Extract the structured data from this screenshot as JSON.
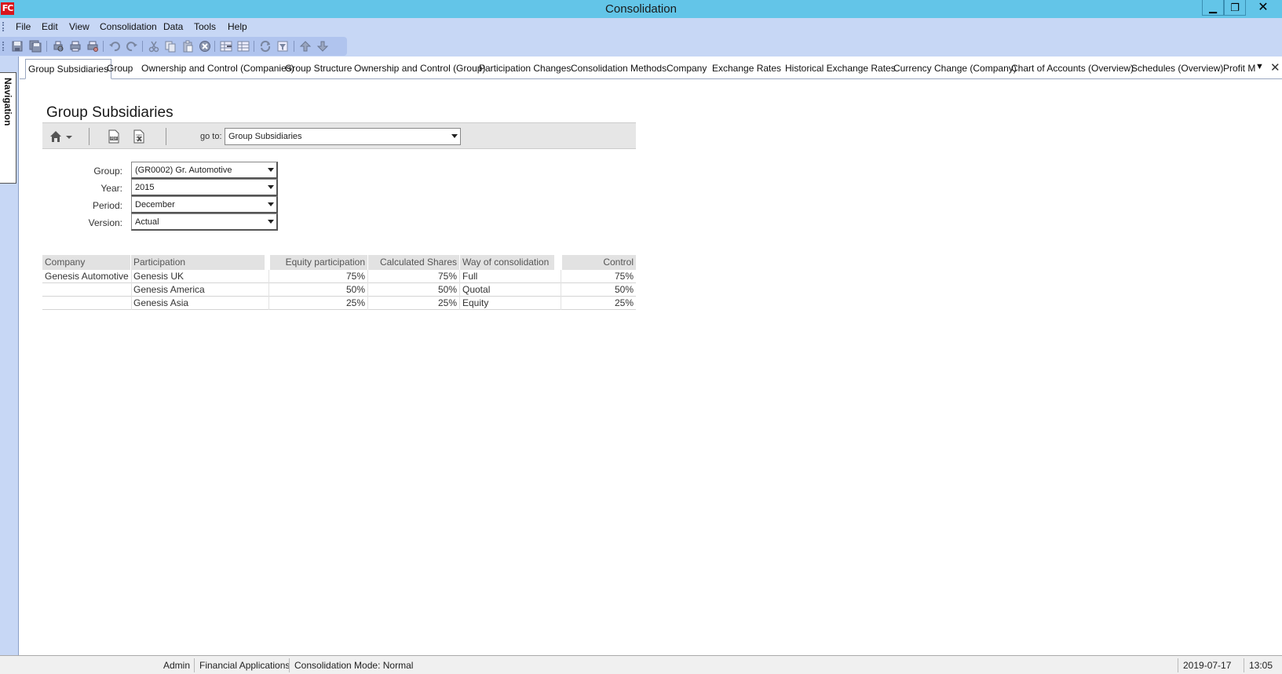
{
  "window": {
    "logo": "FC",
    "title": "Consolidation",
    "minimize": "▁",
    "maximize": "❐",
    "close": "✕"
  },
  "menu": [
    "File",
    "Edit",
    "View",
    "Consolidation",
    "Data",
    "Tools",
    "Help"
  ],
  "navigation": {
    "label": "Navigation"
  },
  "tabs": [
    "Group Subsidiaries",
    "Group",
    "Ownership and Control (Companies)",
    "Group Structure",
    "Ownership and Control (Group)",
    "Participation Changes",
    "Consolidation Methods",
    "Company",
    "Exchange Rates",
    "Historical Exchange Rates",
    "Currency Change (Company)",
    "Chart of Accounts (Overview)",
    "Schedules (Overview)",
    "Profit M"
  ],
  "page": {
    "title": "Group Subsidiaries",
    "goto_label": "go to:",
    "goto_value": "Group Subsidiaries"
  },
  "params": [
    {
      "label": "Group:",
      "value": "(GR0002) Gr. Automotive"
    },
    {
      "label": "Year:",
      "value": "2015"
    },
    {
      "label": "Period:",
      "value": "December"
    },
    {
      "label": "Version:",
      "value": "Actual"
    }
  ],
  "table": {
    "headers": [
      "Company",
      "Participation",
      "Equity participation",
      "Calculated Shares",
      "Way of consolidation",
      "Control"
    ],
    "rows": [
      [
        "Genesis Automotive",
        "Genesis UK",
        "75%",
        "75%",
        "Full",
        "75%"
      ],
      [
        "",
        "Genesis America",
        "50%",
        "50%",
        "Quotal",
        "50%"
      ],
      [
        "",
        "Genesis Asia",
        "25%",
        "25%",
        "Equity",
        "25%"
      ]
    ]
  },
  "status": {
    "user": "Admin",
    "app": "Financial Applications",
    "mode": "Consolidation Mode: Normal",
    "date": "2019-07-17",
    "time": "13:05"
  },
  "colors": {
    "titlebar": "#63c5e8",
    "menubar": "#c7d7f5",
    "logo": "#d9161c"
  }
}
